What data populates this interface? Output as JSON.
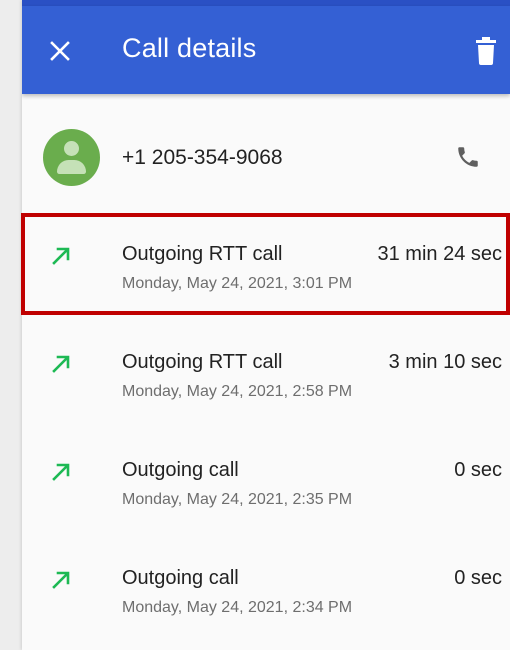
{
  "header": {
    "title": "Call details",
    "close_icon": "close-icon",
    "delete_icon": "trash-icon",
    "bar_color": "#3460d4"
  },
  "contact": {
    "avatar_icon": "person-avatar-icon",
    "avatar_color": "#6aad4d",
    "number": "+1 205-354-9068",
    "call_icon": "phone-icon"
  },
  "calls": [
    {
      "type": "Outgoing RTT call",
      "duration": "31 min 24 sec",
      "date": "Monday, May 24, 2021, 3:01 PM",
      "icon": "outgoing-call-arrow-icon",
      "highlighted": true
    },
    {
      "type": "Outgoing RTT call",
      "duration": "3 min 10 sec",
      "date": "Monday, May 24, 2021, 2:58 PM",
      "icon": "outgoing-call-arrow-icon",
      "highlighted": false
    },
    {
      "type": "Outgoing call",
      "duration": "0 sec",
      "date": "Monday, May 24, 2021, 2:35 PM",
      "icon": "outgoing-call-arrow-icon",
      "highlighted": false
    },
    {
      "type": "Outgoing call",
      "duration": "0 sec",
      "date": "Monday, May 24, 2021, 2:34 PM",
      "icon": "outgoing-call-arrow-icon",
      "highlighted": false
    }
  ],
  "colors": {
    "outgoing_arrow": "#1db954",
    "highlight_border": "#c00000"
  }
}
